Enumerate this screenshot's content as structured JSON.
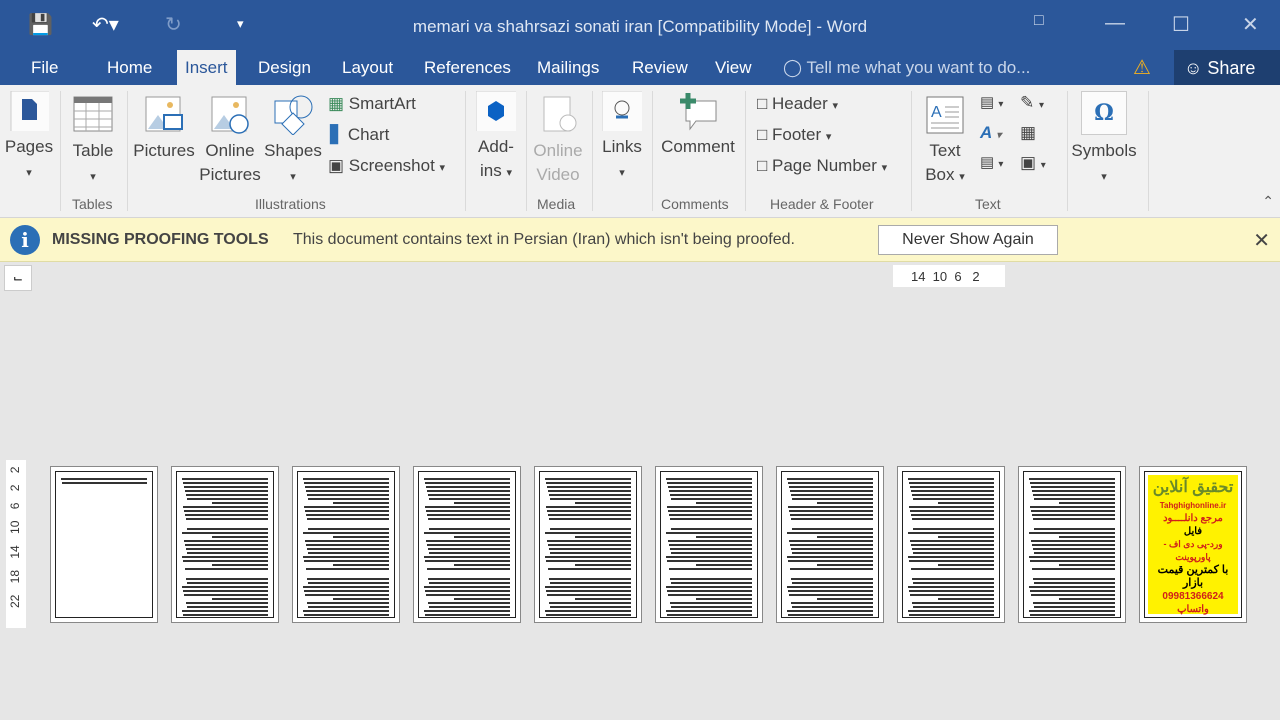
{
  "window": {
    "title": "memari va shahrsazi sonati iran [Compatibility Mode] - Word"
  },
  "tabs": [
    {
      "label": "File"
    },
    {
      "label": "Home"
    },
    {
      "label": "Insert",
      "active": true
    },
    {
      "label": "Design"
    },
    {
      "label": "Layout"
    },
    {
      "label": "References"
    },
    {
      "label": "Mailings"
    },
    {
      "label": "Review"
    },
    {
      "label": "View"
    }
  ],
  "tell_me": {
    "placeholder": "Tell me what you want to do..."
  },
  "share_label": "Share",
  "ribbon": {
    "pages": "Pages",
    "table": "Table",
    "pictures": "Pictures",
    "online_pictures_1": "Online",
    "online_pictures_2": "Pictures",
    "shapes": "Shapes",
    "smartart": "SmartArt",
    "chart": "Chart",
    "screenshot": "Screenshot",
    "addins_1": "Add-",
    "addins_2": "ins",
    "online_video_1": "Online",
    "online_video_2": "Video",
    "links": "Links",
    "comment": "Comment",
    "header": "Header",
    "footer": "Footer",
    "page_number": "Page Number",
    "text_box_1": "Text",
    "text_box_2": "Box",
    "symbols": "Symbols",
    "groups": {
      "tables": "Tables",
      "illustrations": "Illustrations",
      "media": "Media",
      "comments": "Comments",
      "header_footer": "Header & Footer",
      "text": "Text"
    }
  },
  "message_bar": {
    "heading": "MISSING PROOFING TOOLS",
    "body": "This document contains text in Persian (Iran) which isn't being proofed.",
    "button": "Never Show Again"
  },
  "ruler": {
    "horizontal": "14  10  6   2",
    "vertical": [
      "2",
      "2",
      "6",
      "10",
      "14",
      "18",
      "22"
    ]
  },
  "ad_page": {
    "title": "تحقیق آنلاین",
    "site": "Tahghighonline.ir",
    "l1": "مرجع دانلــــود",
    "l2": "فایل",
    "l3": "ورد-پی دی اف - پاورپوینت",
    "l4": "با کمترین قیمت بازار",
    "l5": "09981366624 واتساپ"
  },
  "colors": {
    "brand": "#2b579a",
    "message_bar": "#fcf7c9",
    "ad_yellow": "#fff200"
  }
}
